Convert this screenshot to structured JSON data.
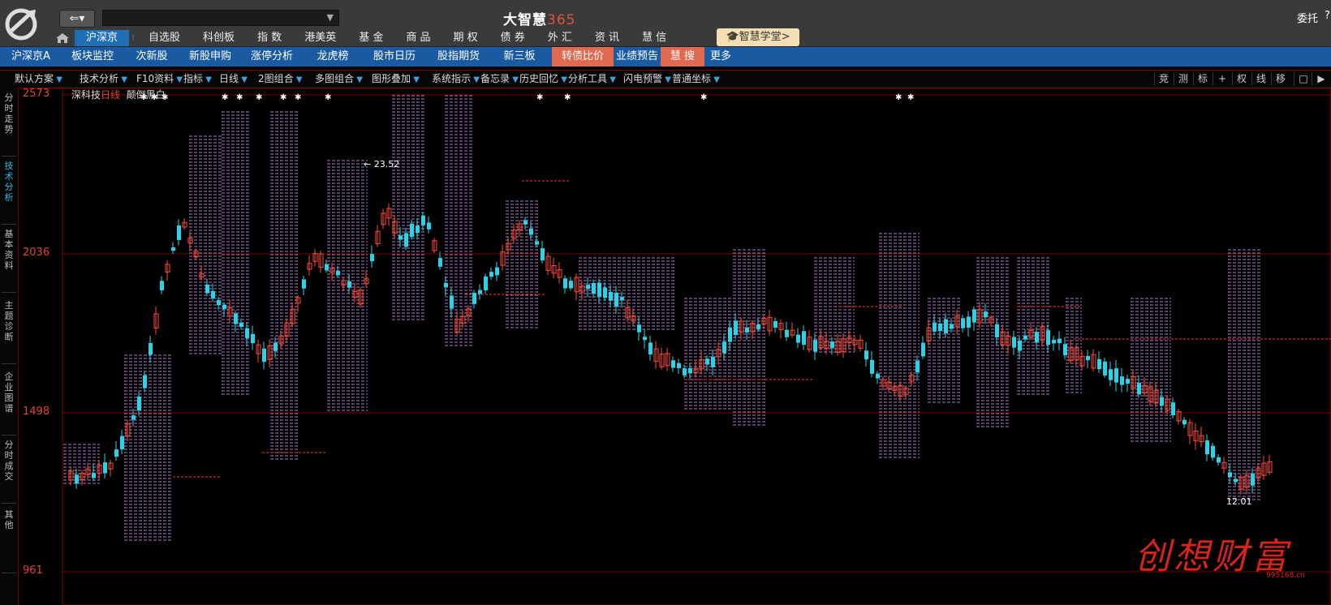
{
  "app": {
    "title": "大智慧",
    "title_num": "365",
    "right_link": "委托",
    "right_q": "?"
  },
  "mainnav": [
    "沪深京",
    "自选股",
    "科创板",
    "指  数",
    "港美英",
    "基  金",
    "商  品",
    "期  权",
    "债  券",
    "外  汇",
    "资  讯",
    "慧  信"
  ],
  "xuetang": "智慧学堂>",
  "subnav": [
    "沪深京A",
    "板块监控",
    "次新股",
    "新股申购",
    "涨停分析",
    "龙虎榜",
    "股市日历",
    "股指期货",
    "新三板",
    "转债比价",
    "业绩预告",
    "慧  搜",
    "更多"
  ],
  "toolbar": [
    "默认方案",
    "技术分析",
    "F10资料",
    "指标",
    "日线",
    "2图组合",
    "多图组合",
    "图形叠加",
    "系统指示",
    "备忘录",
    "历史回忆",
    "分析工具",
    "闪电预警",
    "普通坐标"
  ],
  "toolbar_icons": [
    "竞",
    "测",
    "标",
    "+",
    "权",
    "线",
    "移",
    "□",
    "▶"
  ],
  "sidebar": [
    "分时走势",
    "技术分析",
    "基本资料",
    "主题诊断",
    "企业图谱",
    "分时成交",
    "其他"
  ],
  "chart": {
    "stock": "深科技",
    "period": "日线",
    "mode": "颠倒黑白",
    "y_labels": [
      "2573",
      "2036",
      "1498",
      "961"
    ],
    "annotation": "23.52",
    "last_price": "12.01"
  },
  "watermark": {
    "text": "创想财富",
    "url": "995168.cn"
  },
  "colors": {
    "up": "#ff4a3a",
    "down": "#2ad3e6",
    "grid": "#7a0000",
    "yellow": "#f0e020",
    "purple": "#d898ff",
    "nav_blue": "#1a5aa0"
  }
}
